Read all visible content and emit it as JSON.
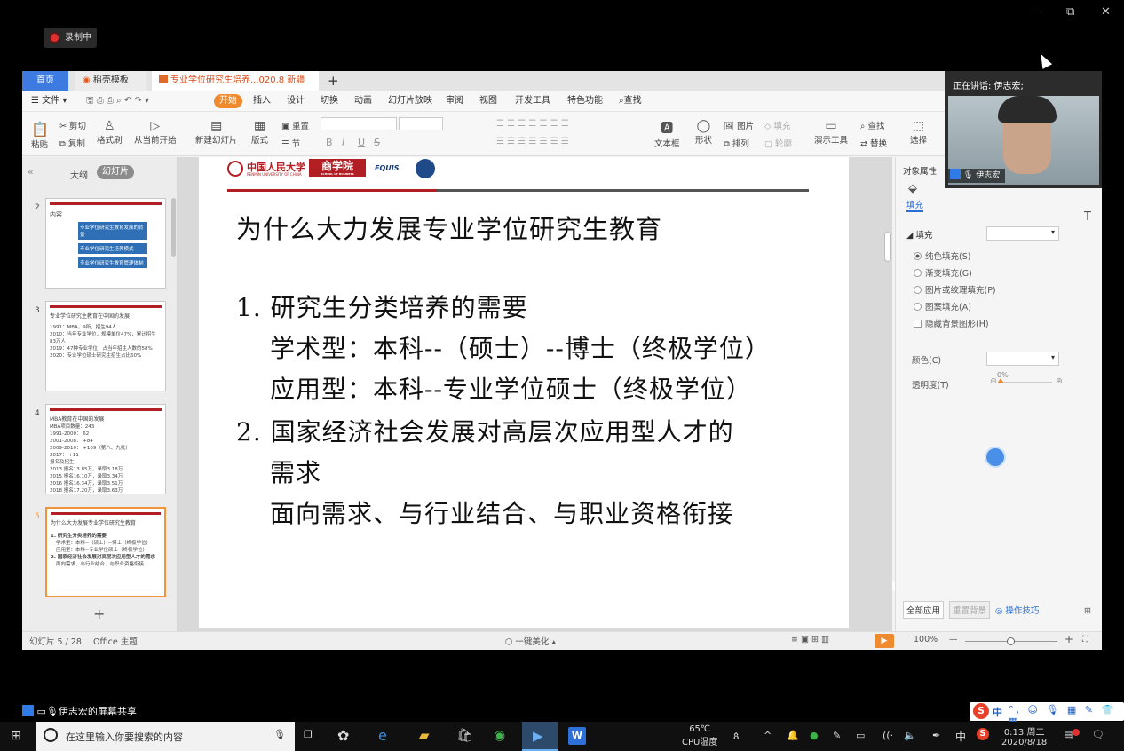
{
  "recording": {
    "label": "录制中"
  },
  "window_controls": [
    "—",
    "⧉",
    "✕"
  ],
  "tabs": {
    "home": "首页",
    "template": "稻壳模板",
    "doc": "专业学位研究生培养...020.8 新疆 )",
    "add": "+"
  },
  "menu": {
    "file": "文件",
    "start": "开始",
    "items": [
      "插入",
      "设计",
      "切换",
      "动画",
      "幻灯片放映",
      "审阅",
      "视图",
      "开发工具",
      "特色功能"
    ],
    "search": "查找"
  },
  "ribbon": {
    "paste": "粘贴",
    "cut": "剪切",
    "copy": "复制",
    "format_painter": "格式刷",
    "from_current": "从当前开始",
    "new_slide": "新建幻灯片",
    "layout": "版式",
    "reset": "重置",
    "section": "节",
    "textbox": "文本框",
    "shape": "形状",
    "picture": "图片",
    "arrange": "排列",
    "fill": "填充",
    "outline": "轮廓",
    "demo_tools": "演示工具",
    "find": "查找",
    "replace": "替换",
    "select": "选择",
    "bold": "B",
    "italic": "I",
    "underline": "U",
    "strike": "S"
  },
  "left_panel": {
    "outline_tab": "大纲",
    "slides_tab": "幻灯片",
    "add": "+"
  },
  "thumbnails": [
    {
      "num": "2",
      "title": "内容",
      "lines": [
        "专业学位研究生教育发展的背景",
        "专业学位研究生培养模式",
        "专业学位研究生教育管理体制"
      ]
    },
    {
      "num": "3",
      "title": "专业学位研究生教育在中国的发展",
      "lines": [
        "1991：MBA，9所，招生94人",
        "2010：当年专业学位，规模单位47%，累计招生83万人",
        "2019：47种专业学位，占当年招生人数的58%",
        "2020：专业学位硕士研究生招生占比60%"
      ]
    },
    {
      "num": "4",
      "title": "MBA教育在中国的发展",
      "lines": [
        "MBA项目数量：243",
        "1991-2000：  62",
        "2001-2008：  +84",
        "2009-2010：  +109（第八、九批）",
        "2017：  +11",
        "报名及招生",
        "2013 报名13.85万，录取3.18万",
        "2015 报名16.10万，录取3.34万",
        "2016 报名16.34万，录取3.51万",
        "2018 报名17.20万，录取3.63万"
      ]
    },
    {
      "num": "5",
      "title": "为什么大力发展专业学位研究生教育",
      "lines": [
        "1. 研究生分类培养的需要",
        "学术型：本科--（硕士）--博士（终极学位）",
        "应用型：本科--专业学位硕士（终极学位）",
        "2. 国家经济社会发展对高层次应用型人才的需求",
        "面向需求、与行业结合、与职业资格衔接"
      ]
    }
  ],
  "slide": {
    "logo_univ": "中国人民大学",
    "logo_univ_en": "RENMIN UNIVERSITY OF CHINA",
    "logo_school": "商学院",
    "logo_school_en": "SCHOOL OF BUSINESS",
    "logo_equis": "EQUIS",
    "title": "为什么大力发展专业学位研究生教育",
    "item1": "1.  研究生分类培养的需要",
    "item1_a": "学术型：本科--（硕士）--博士（终极学位）",
    "item1_b": "应用型：本科--专业学位硕士（终极学位）",
    "item2_line1": "2.  国家经济社会发展对高层次应用型人才的",
    "item2_line2": "需求",
    "item2_a": "面向需求、与行业结合、与职业资格衔接"
  },
  "right_panel": {
    "header": "对象属性",
    "fill_tab": "填充",
    "fill_section": "填充",
    "options": [
      "纯色填充(S)",
      "渐变填充(G)",
      "图片或纹理填充(P)",
      "图案填充(A)"
    ],
    "hide_bg": "隐藏背景图形(H)",
    "color_label": "颜色(C)",
    "transparency_label": "透明度(T)",
    "transparency_value": "0%",
    "transparency_fraction": 0,
    "apply_all": "全部应用",
    "reset_bg": "重置背景",
    "tips": "操作技巧"
  },
  "status": {
    "slide_count": "幻灯片 5 / 28",
    "theme": "Office 主题",
    "beautify": "一键美化",
    "zoom": "100%",
    "zoom_fraction": 0.5
  },
  "video": {
    "speaking": "正在讲话: 伊志宏;",
    "name": "伊志宏"
  },
  "share_label": "伊志宏的屏幕共享",
  "taskbar": {
    "search_placeholder": "在这里输入你要搜索的内容",
    "temp": "65℃",
    "temp_label": "CPU温度",
    "ime": "中",
    "time": "0:13 周二",
    "date": "2020/8/18"
  },
  "colors": {
    "accent_orange": "#f08a2e",
    "tab_blue": "#3d7be0",
    "slide_red": "#b11f24"
  }
}
